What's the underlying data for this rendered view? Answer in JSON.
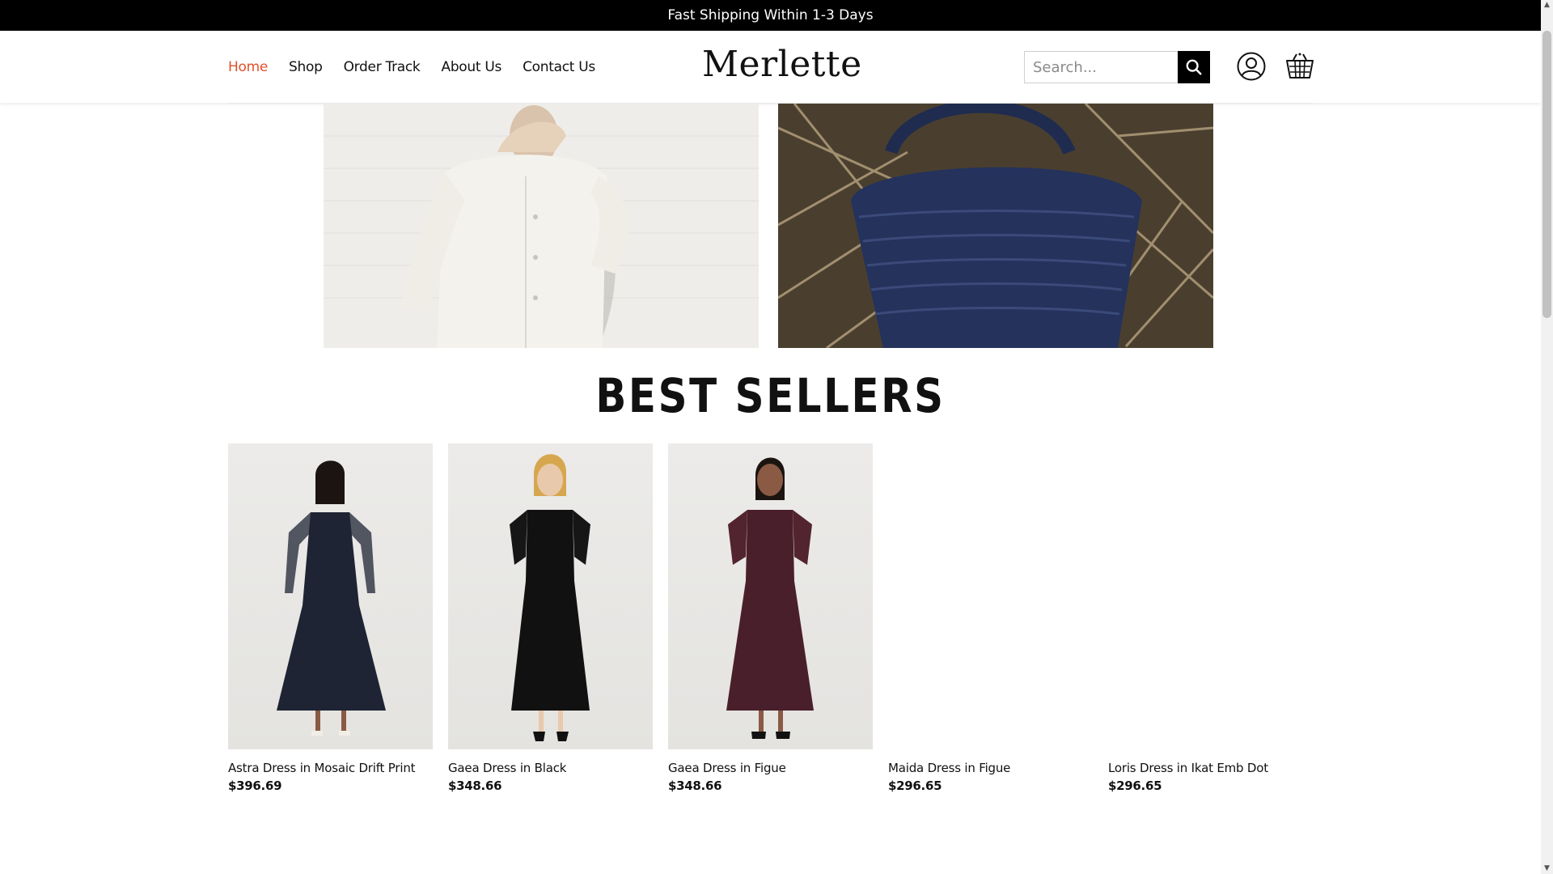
{
  "announcement": "Fast Shipping Within 1-3 Days",
  "nav": {
    "items": [
      {
        "label": "Home",
        "active": true
      },
      {
        "label": "Shop",
        "active": false
      },
      {
        "label": "Order Track",
        "active": false
      },
      {
        "label": "About Us",
        "active": false
      },
      {
        "label": "Contact Us",
        "active": false
      }
    ]
  },
  "brand": {
    "name": "Merlette"
  },
  "search": {
    "placeholder": "Search..."
  },
  "icons": {
    "search": "search-icon",
    "account": "user-circle-icon",
    "cart": "shopping-basket-icon"
  },
  "colors": {
    "accent": "#e2512b",
    "topbar": "#000000",
    "text": "#111111"
  },
  "best_sellers": {
    "title": "BEST SELLERS",
    "products": [
      {
        "name": "Astra Dress in Mosaic Drift Print",
        "price": "$396.69",
        "color": "#1e2433"
      },
      {
        "name": "Gaea Dress in Black",
        "price": "$348.66",
        "color": "#111111"
      },
      {
        "name": "Gaea Dress in Figue",
        "price": "$348.66",
        "color": "#4a1f2c"
      },
      {
        "name": "Maida Dress in Figue",
        "price": "$296.65",
        "color": null
      },
      {
        "name": "Loris Dress in Ikat Emb Dot",
        "price": "$296.65",
        "color": null
      }
    ]
  }
}
